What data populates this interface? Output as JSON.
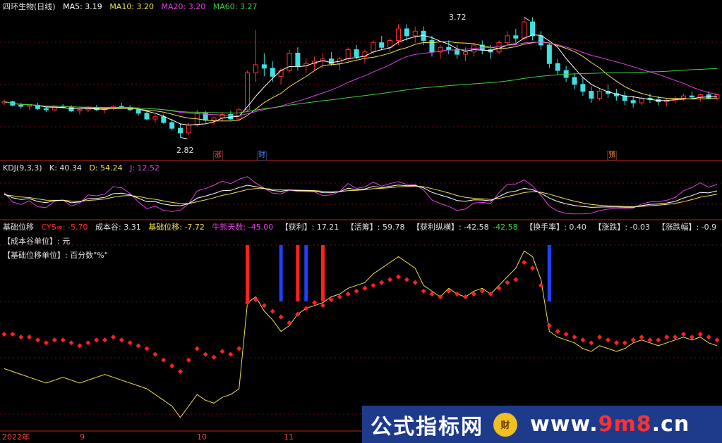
{
  "main": {
    "title": "四环生物(日线)",
    "ma_legend": [
      {
        "label": "MA5: 3.19",
        "color": "#ffffff"
      },
      {
        "label": "MA10: 3.20",
        "color": "#f0e050"
      },
      {
        "label": "MA20: 3.20",
        "color": "#e040e0"
      },
      {
        "label": "MA60: 3.27",
        "color": "#40d040"
      }
    ],
    "high_label": "3.72",
    "low_label": "2.82",
    "events": [
      {
        "text": "涨",
        "color": "#ff5050"
      },
      {
        "text": "财",
        "color": "#5080ff"
      },
      {
        "text": "预",
        "color": "#ff9030"
      }
    ]
  },
  "kdj": {
    "title": "KDJ(9,3,3)",
    "k": "K: 40.34",
    "d": "D: 54.24",
    "j": "J: 12.52"
  },
  "indicator": {
    "title": "基础位移",
    "items": [
      {
        "label": "CYS∞: -5.70",
        "color": "#ff3030"
      },
      {
        "label": "成本谷: 3.31",
        "color": "#e0e0e0"
      },
      {
        "label": "基础位移: -7.72",
        "color": "#f0e050"
      },
      {
        "label": "牛熊天数: -45.00",
        "color": "#e040e0"
      },
      {
        "label": "【获利】: 17.21",
        "color": "#e0e0e0"
      },
      {
        "label": "【活筹】: 59.78",
        "color": "#e0e0e0"
      },
      {
        "label": "【获利纵横】: -42.58",
        "color": "#e0e0e0"
      },
      {
        "label": "-42.58",
        "color": "#40d040"
      },
      {
        "label": "【换手率】: 0.40",
        "color": "#e0e0e0"
      },
      {
        "label": "【涨跌】: -0.03",
        "color": "#e0e0e0"
      },
      {
        "label": "【涨跌幅】: -0.9",
        "color": "#e0e0e0"
      }
    ],
    "unit_lines": [
      "【成本谷单位】: 元",
      "【基础位移单位】: 百分数\"%\""
    ]
  },
  "x_axis": {
    "ticks": [
      "2022年",
      "9",
      "10",
      "11"
    ]
  },
  "watermark": {
    "left": "公式指标网",
    "icon": "财",
    "right_pre": "www.",
    "right_mid": "9m8",
    "right_post": ".cn"
  },
  "chart_data": [
    {
      "type": "candlestick",
      "title": "四环生物(日线)",
      "ylim": [
        2.7,
        3.9
      ],
      "series_names": [
        "MA5",
        "MA10",
        "MA20",
        "MA60"
      ],
      "annotations": {
        "high": 3.72,
        "low": 2.82
      },
      "ohlc": [
        [
          3.12,
          3.15,
          3.1,
          3.13
        ],
        [
          3.13,
          3.14,
          3.09,
          3.1
        ],
        [
          3.1,
          3.12,
          3.07,
          3.09
        ],
        [
          3.09,
          3.11,
          3.06,
          3.1
        ],
        [
          3.1,
          3.12,
          3.06,
          3.07
        ],
        [
          3.07,
          3.09,
          3.04,
          3.06
        ],
        [
          3.06,
          3.1,
          3.05,
          3.09
        ],
        [
          3.09,
          3.11,
          3.07,
          3.08
        ],
        [
          3.08,
          3.1,
          3.04,
          3.05
        ],
        [
          3.05,
          3.07,
          3.02,
          3.06
        ],
        [
          3.06,
          3.09,
          3.04,
          3.08
        ],
        [
          3.08,
          3.1,
          3.05,
          3.06
        ],
        [
          3.06,
          3.08,
          3.03,
          3.07
        ],
        [
          3.07,
          3.1,
          3.06,
          3.09
        ],
        [
          3.09,
          3.12,
          3.07,
          3.08
        ],
        [
          3.08,
          3.1,
          3.05,
          3.06
        ],
        [
          3.06,
          3.07,
          3.01,
          3.03
        ],
        [
          3.03,
          3.05,
          2.97,
          2.98
        ],
        [
          2.98,
          3.02,
          2.95,
          3.0
        ],
        [
          3.0,
          3.02,
          2.94,
          2.95
        ],
        [
          2.95,
          2.98,
          2.88,
          2.9
        ],
        [
          2.9,
          2.94,
          2.82,
          2.86
        ],
        [
          2.86,
          2.95,
          2.84,
          2.93
        ],
        [
          2.93,
          3.06,
          2.91,
          3.03
        ],
        [
          3.03,
          3.05,
          2.95,
          2.97
        ],
        [
          2.97,
          3.0,
          2.93,
          2.99
        ],
        [
          2.99,
          3.04,
          2.96,
          3.02
        ],
        [
          3.02,
          3.05,
          2.97,
          2.98
        ],
        [
          2.98,
          3.08,
          2.97,
          3.06
        ],
        [
          3.06,
          3.4,
          3.05,
          3.38
        ],
        [
          3.38,
          3.75,
          3.3,
          3.45
        ],
        [
          3.45,
          3.55,
          3.35,
          3.42
        ],
        [
          3.42,
          3.48,
          3.3,
          3.35
        ],
        [
          3.35,
          3.42,
          3.28,
          3.4
        ],
        [
          3.4,
          3.58,
          3.38,
          3.55
        ],
        [
          3.55,
          3.6,
          3.4,
          3.44
        ],
        [
          3.44,
          3.5,
          3.38,
          3.46
        ],
        [
          3.46,
          3.52,
          3.4,
          3.48
        ],
        [
          3.48,
          3.55,
          3.42,
          3.5
        ],
        [
          3.5,
          3.56,
          3.44,
          3.46
        ],
        [
          3.46,
          3.52,
          3.4,
          3.5
        ],
        [
          3.5,
          3.6,
          3.48,
          3.58
        ],
        [
          3.58,
          3.62,
          3.5,
          3.52
        ],
        [
          3.52,
          3.58,
          3.46,
          3.56
        ],
        [
          3.56,
          3.66,
          3.54,
          3.64
        ],
        [
          3.64,
          3.7,
          3.58,
          3.6
        ],
        [
          3.6,
          3.68,
          3.56,
          3.66
        ],
        [
          3.66,
          3.8,
          3.62,
          3.76
        ],
        [
          3.76,
          3.8,
          3.66,
          3.7
        ],
        [
          3.7,
          3.78,
          3.64,
          3.74
        ],
        [
          3.74,
          3.78,
          3.62,
          3.66
        ],
        [
          3.66,
          3.7,
          3.52,
          3.56
        ],
        [
          3.56,
          3.62,
          3.5,
          3.6
        ],
        [
          3.6,
          3.66,
          3.54,
          3.58
        ],
        [
          3.58,
          3.62,
          3.5,
          3.54
        ],
        [
          3.54,
          3.6,
          3.48,
          3.56
        ],
        [
          3.56,
          3.64,
          3.52,
          3.62
        ],
        [
          3.62,
          3.66,
          3.54,
          3.58
        ],
        [
          3.58,
          3.62,
          3.5,
          3.56
        ],
        [
          3.56,
          3.66,
          3.54,
          3.64
        ],
        [
          3.64,
          3.74,
          3.62,
          3.7
        ],
        [
          3.7,
          3.76,
          3.64,
          3.68
        ],
        [
          3.68,
          3.86,
          3.66,
          3.82
        ],
        [
          3.82,
          3.86,
          3.66,
          3.7
        ],
        [
          3.7,
          3.74,
          3.58,
          3.62
        ],
        [
          3.62,
          3.64,
          3.42,
          3.46
        ],
        [
          3.46,
          3.5,
          3.36,
          3.4
        ],
        [
          3.4,
          3.44,
          3.3,
          3.34
        ],
        [
          3.34,
          3.38,
          3.24,
          3.28
        ],
        [
          3.28,
          3.34,
          3.18,
          3.22
        ],
        [
          3.22,
          3.26,
          3.12,
          3.16
        ],
        [
          3.16,
          3.24,
          3.14,
          3.22
        ],
        [
          3.22,
          3.28,
          3.16,
          3.2
        ],
        [
          3.2,
          3.24,
          3.14,
          3.18
        ],
        [
          3.18,
          3.22,
          3.1,
          3.14
        ],
        [
          3.14,
          3.18,
          3.08,
          3.12
        ],
        [
          3.12,
          3.18,
          3.1,
          3.16
        ],
        [
          3.16,
          3.2,
          3.12,
          3.15
        ],
        [
          3.15,
          3.18,
          3.1,
          3.13
        ],
        [
          3.13,
          3.16,
          3.09,
          3.14
        ],
        [
          3.14,
          3.18,
          3.12,
          3.16
        ],
        [
          3.16,
          3.2,
          3.14,
          3.18
        ],
        [
          3.18,
          3.22,
          3.15,
          3.17
        ],
        [
          3.17,
          3.2,
          3.13,
          3.19
        ],
        [
          3.19,
          3.22,
          3.15,
          3.16
        ],
        [
          3.16,
          3.2,
          3.14,
          3.19
        ]
      ]
    },
    {
      "type": "line",
      "title": "KDJ(9,3,3)",
      "series_names": [
        "K",
        "D",
        "J"
      ],
      "last_values": {
        "K": 40.34,
        "D": 54.24,
        "J": 12.52
      }
    },
    {
      "type": "line",
      "title": "基础位移",
      "series_names": [
        "CYS∞",
        "成本谷",
        "基础位移",
        "牛熊天数"
      ],
      "last_values": {
        "CYS∞": -5.7,
        "成本谷": 3.31,
        "基础位移": -7.72,
        "牛熊天数": -45.0
      },
      "cys": [
        -3,
        -3,
        -4,
        -4,
        -5,
        -6,
        -5,
        -5,
        -6,
        -7,
        -6,
        -5,
        -5,
        -4,
        -5,
        -6,
        -7,
        -8,
        -10,
        -12,
        -14,
        -16,
        -12,
        -8,
        -10,
        -11,
        -9,
        -10,
        -8,
        8,
        9,
        7,
        5,
        3,
        1,
        4,
        6,
        8,
        7,
        9,
        10,
        11,
        12,
        13,
        14,
        15,
        16,
        17,
        16,
        15,
        12,
        11,
        10,
        12,
        11,
        10,
        11,
        12,
        11,
        13,
        15,
        16,
        22,
        20,
        14,
        0,
        -2,
        -3,
        -4,
        -5,
        -6,
        -4,
        -5,
        -6,
        -6,
        -5,
        -4,
        -5,
        -5,
        -4,
        -4,
        -3,
        -4,
        -3,
        -4,
        -5
      ],
      "shift": [
        -15,
        -16,
        -17,
        -18,
        -19,
        -20,
        -19,
        -18,
        -19,
        -20,
        -19,
        -18,
        -17,
        -18,
        -19,
        -20,
        -21,
        -22,
        -24,
        -26,
        -28,
        -32,
        -28,
        -24,
        -26,
        -27,
        -25,
        -24,
        -22,
        8,
        10,
        5,
        2,
        -2,
        0,
        4,
        6,
        7,
        8,
        10,
        11,
        13,
        14,
        15,
        18,
        20,
        22,
        24,
        22,
        20,
        14,
        12,
        10,
        13,
        11,
        10,
        12,
        13,
        11,
        14,
        17,
        20,
        26,
        24,
        16,
        -2,
        -4,
        -5,
        -6,
        -8,
        -9,
        -7,
        -8,
        -9,
        -8,
        -6,
        -5,
        -6,
        -7,
        -6,
        -5,
        -4,
        -5,
        -4,
        -6,
        -7
      ],
      "markers": [
        {
          "index": 29,
          "color": "#ff2020"
        },
        {
          "index": 33,
          "color": "#2040ff"
        },
        {
          "index": 35,
          "color": "#ff2020"
        },
        {
          "index": 36,
          "color": "#2040ff"
        },
        {
          "index": 38,
          "color": "#ff2020"
        },
        {
          "index": 65,
          "color": "#2040ff"
        }
      ]
    }
  ]
}
